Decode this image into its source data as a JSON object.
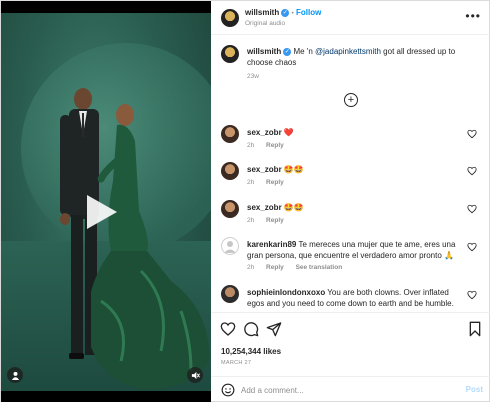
{
  "header": {
    "username": "willsmith",
    "follow_separator": "•",
    "follow_label": "Follow",
    "audio_label": "Original audio",
    "more_label": "•••"
  },
  "caption": {
    "username": "willsmith",
    "text_before": "Me 'n ",
    "mention": "@jadapinkettsmith",
    "text_after": " got all dressed up to choose chaos",
    "time": "23w"
  },
  "load_more_label": "+",
  "comments": [
    {
      "username": "sex_zobr",
      "text": "❤️",
      "time": "2h",
      "reply": "Reply"
    },
    {
      "username": "sex_zobr",
      "text": "🤩🤩",
      "time": "2h",
      "reply": "Reply"
    },
    {
      "username": "sex_zobr",
      "text": "🤩🤩",
      "time": "2h",
      "reply": "Reply"
    },
    {
      "username": "karenkarin89",
      "text": "Te mereces una mujer que te ame, eres una gran persona, que encuentre el verdadero amor pronto 🙏",
      "time": "2h",
      "reply": "Reply",
      "translation": "See translation"
    },
    {
      "username": "sophieinlondonxoxo",
      "text": "You are both clowns. Over inflated egos and you need to come down to earth and be humble.",
      "time": "",
      "reply": ""
    }
  ],
  "likes_label": "10,254,344 likes",
  "date_label": "MARCH 27",
  "add_comment": {
    "placeholder": "Add a comment...",
    "post_label": "Post"
  },
  "colors": {
    "accent_blue": "#0095f6",
    "verified_blue": "#3897f0",
    "heart_red": "#ed4956",
    "post_disabled": "#b3dbff",
    "backdrop_green": "#2a5e50",
    "dress_green": "#1f5a3c"
  },
  "icons": [
    "verified-icon",
    "more-icon",
    "plus-circle-icon",
    "heart-icon",
    "comment-icon",
    "share-icon",
    "bookmark-icon",
    "emoji-icon",
    "play-icon",
    "user-tag-icon",
    "mute-icon"
  ]
}
